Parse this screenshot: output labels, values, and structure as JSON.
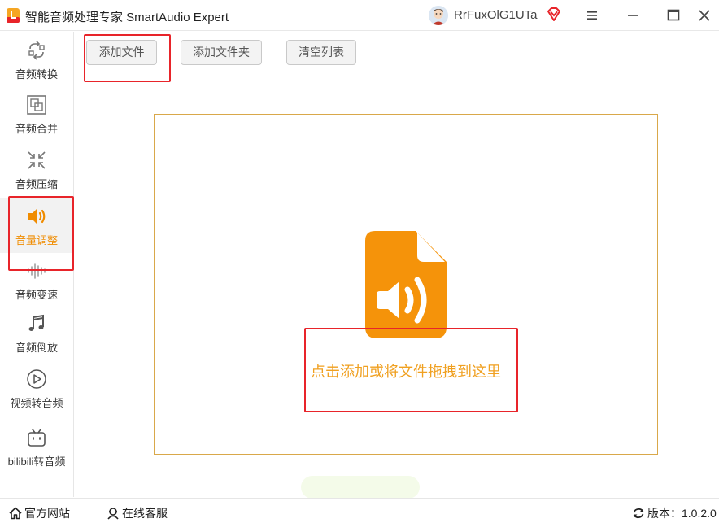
{
  "app": {
    "title": "智能音频处理专家 SmartAudio Expert",
    "username": "RrFuxOlG1UTa"
  },
  "window_controls": {
    "menu": "menu-icon",
    "minimize": "minimize-icon",
    "maximize": "maximize-icon",
    "close": "close-icon"
  },
  "sidebar": {
    "items": [
      {
        "label": "音频转换",
        "icon": "convert-icon"
      },
      {
        "label": "音频合并",
        "icon": "merge-icon"
      },
      {
        "label": "音频压缩",
        "icon": "compress-icon"
      },
      {
        "label": "音量调整",
        "icon": "volume-icon",
        "active": true
      },
      {
        "label": "音频变速",
        "icon": "waveform-icon"
      },
      {
        "label": "音频倒放",
        "icon": "music-note-icon"
      },
      {
        "label": "视频转音频",
        "icon": "play-icon"
      },
      {
        "label": "bilibili转音频",
        "icon": "bilibili-icon"
      }
    ]
  },
  "toolbar": {
    "add_file": "添加文件",
    "add_folder": "添加文件夹",
    "clear_list": "清空列表"
  },
  "dropzone": {
    "hint": "点击添加或将文件拖拽到这里",
    "icon": "audio-file-icon"
  },
  "statusbar": {
    "website": "官方网站",
    "support": "在线客服",
    "version": "版本：1.0.2.0"
  },
  "colors": {
    "accent": "#f08c00",
    "hint_text": "#f0a020",
    "annotation": "#e8242a",
    "dropzone_border": "#d9a84a"
  }
}
